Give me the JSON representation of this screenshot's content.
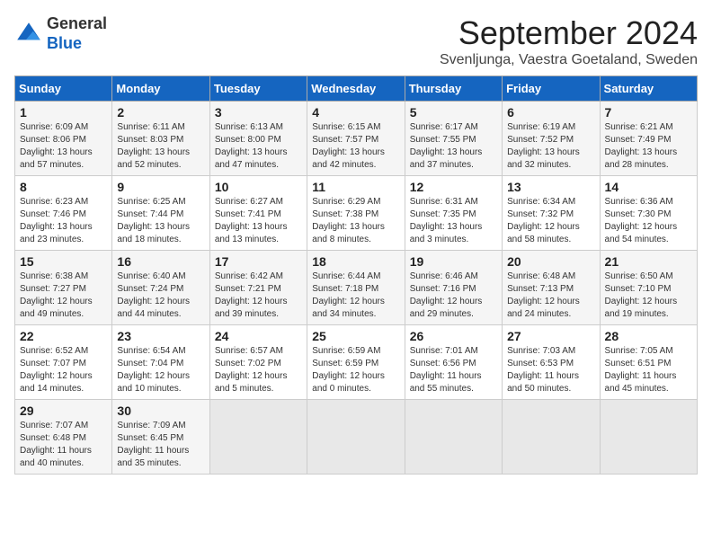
{
  "header": {
    "logo_general": "General",
    "logo_blue": "Blue",
    "month_year": "September 2024",
    "location": "Svenljunga, Vaestra Goetaland, Sweden"
  },
  "weekdays": [
    "Sunday",
    "Monday",
    "Tuesday",
    "Wednesday",
    "Thursday",
    "Friday",
    "Saturday"
  ],
  "weeks": [
    [
      {
        "day": "1",
        "sunrise": "6:09 AM",
        "sunset": "8:06 PM",
        "daylight": "13 hours and 57 minutes."
      },
      {
        "day": "2",
        "sunrise": "6:11 AM",
        "sunset": "8:03 PM",
        "daylight": "13 hours and 52 minutes."
      },
      {
        "day": "3",
        "sunrise": "6:13 AM",
        "sunset": "8:00 PM",
        "daylight": "13 hours and 47 minutes."
      },
      {
        "day": "4",
        "sunrise": "6:15 AM",
        "sunset": "7:57 PM",
        "daylight": "13 hours and 42 minutes."
      },
      {
        "day": "5",
        "sunrise": "6:17 AM",
        "sunset": "7:55 PM",
        "daylight": "13 hours and 37 minutes."
      },
      {
        "day": "6",
        "sunrise": "6:19 AM",
        "sunset": "7:52 PM",
        "daylight": "13 hours and 32 minutes."
      },
      {
        "day": "7",
        "sunrise": "6:21 AM",
        "sunset": "7:49 PM",
        "daylight": "13 hours and 28 minutes."
      }
    ],
    [
      {
        "day": "8",
        "sunrise": "6:23 AM",
        "sunset": "7:46 PM",
        "daylight": "13 hours and 23 minutes."
      },
      {
        "day": "9",
        "sunrise": "6:25 AM",
        "sunset": "7:44 PM",
        "daylight": "13 hours and 18 minutes."
      },
      {
        "day": "10",
        "sunrise": "6:27 AM",
        "sunset": "7:41 PM",
        "daylight": "13 hours and 13 minutes."
      },
      {
        "day": "11",
        "sunrise": "6:29 AM",
        "sunset": "7:38 PM",
        "daylight": "13 hours and 8 minutes."
      },
      {
        "day": "12",
        "sunrise": "6:31 AM",
        "sunset": "7:35 PM",
        "daylight": "13 hours and 3 minutes."
      },
      {
        "day": "13",
        "sunrise": "6:34 AM",
        "sunset": "7:32 PM",
        "daylight": "12 hours and 58 minutes."
      },
      {
        "day": "14",
        "sunrise": "6:36 AM",
        "sunset": "7:30 PM",
        "daylight": "12 hours and 54 minutes."
      }
    ],
    [
      {
        "day": "15",
        "sunrise": "6:38 AM",
        "sunset": "7:27 PM",
        "daylight": "12 hours and 49 minutes."
      },
      {
        "day": "16",
        "sunrise": "6:40 AM",
        "sunset": "7:24 PM",
        "daylight": "12 hours and 44 minutes."
      },
      {
        "day": "17",
        "sunrise": "6:42 AM",
        "sunset": "7:21 PM",
        "daylight": "12 hours and 39 minutes."
      },
      {
        "day": "18",
        "sunrise": "6:44 AM",
        "sunset": "7:18 PM",
        "daylight": "12 hours and 34 minutes."
      },
      {
        "day": "19",
        "sunrise": "6:46 AM",
        "sunset": "7:16 PM",
        "daylight": "12 hours and 29 minutes."
      },
      {
        "day": "20",
        "sunrise": "6:48 AM",
        "sunset": "7:13 PM",
        "daylight": "12 hours and 24 minutes."
      },
      {
        "day": "21",
        "sunrise": "6:50 AM",
        "sunset": "7:10 PM",
        "daylight": "12 hours and 19 minutes."
      }
    ],
    [
      {
        "day": "22",
        "sunrise": "6:52 AM",
        "sunset": "7:07 PM",
        "daylight": "12 hours and 14 minutes."
      },
      {
        "day": "23",
        "sunrise": "6:54 AM",
        "sunset": "7:04 PM",
        "daylight": "12 hours and 10 minutes."
      },
      {
        "day": "24",
        "sunrise": "6:57 AM",
        "sunset": "7:02 PM",
        "daylight": "12 hours and 5 minutes."
      },
      {
        "day": "25",
        "sunrise": "6:59 AM",
        "sunset": "6:59 PM",
        "daylight": "12 hours and 0 minutes."
      },
      {
        "day": "26",
        "sunrise": "7:01 AM",
        "sunset": "6:56 PM",
        "daylight": "11 hours and 55 minutes."
      },
      {
        "day": "27",
        "sunrise": "7:03 AM",
        "sunset": "6:53 PM",
        "daylight": "11 hours and 50 minutes."
      },
      {
        "day": "28",
        "sunrise": "7:05 AM",
        "sunset": "6:51 PM",
        "daylight": "11 hours and 45 minutes."
      }
    ],
    [
      {
        "day": "29",
        "sunrise": "7:07 AM",
        "sunset": "6:48 PM",
        "daylight": "11 hours and 40 minutes."
      },
      {
        "day": "30",
        "sunrise": "7:09 AM",
        "sunset": "6:45 PM",
        "daylight": "11 hours and 35 minutes."
      },
      null,
      null,
      null,
      null,
      null
    ]
  ]
}
